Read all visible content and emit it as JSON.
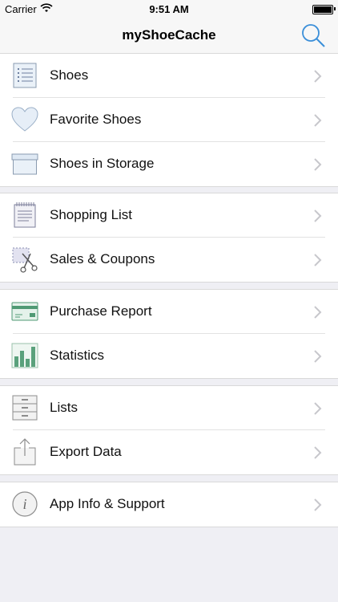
{
  "status": {
    "carrier": "Carrier",
    "time": "9:51 AM"
  },
  "nav": {
    "title": "myShoeCache"
  },
  "sections": [
    [
      {
        "label": "Shoes",
        "icon": "list-icon"
      },
      {
        "label": "Favorite Shoes",
        "icon": "heart-icon"
      },
      {
        "label": "Shoes in Storage",
        "icon": "storage-box-icon"
      }
    ],
    [
      {
        "label": "Shopping List",
        "icon": "notepad-icon"
      },
      {
        "label": "Sales & Coupons",
        "icon": "scissors-coupon-icon"
      }
    ],
    [
      {
        "label": "Purchase Report",
        "icon": "credit-card-icon"
      },
      {
        "label": "Statistics",
        "icon": "bar-chart-icon"
      }
    ],
    [
      {
        "label": "Lists",
        "icon": "file-cabinet-icon"
      },
      {
        "label": "Export Data",
        "icon": "share-export-icon"
      }
    ],
    [
      {
        "label": "App Info & Support",
        "icon": "info-icon"
      }
    ]
  ],
  "colors": {
    "accent": "#3b8fd9",
    "background": "#efeff4",
    "chevron": "#c7c7cc"
  }
}
